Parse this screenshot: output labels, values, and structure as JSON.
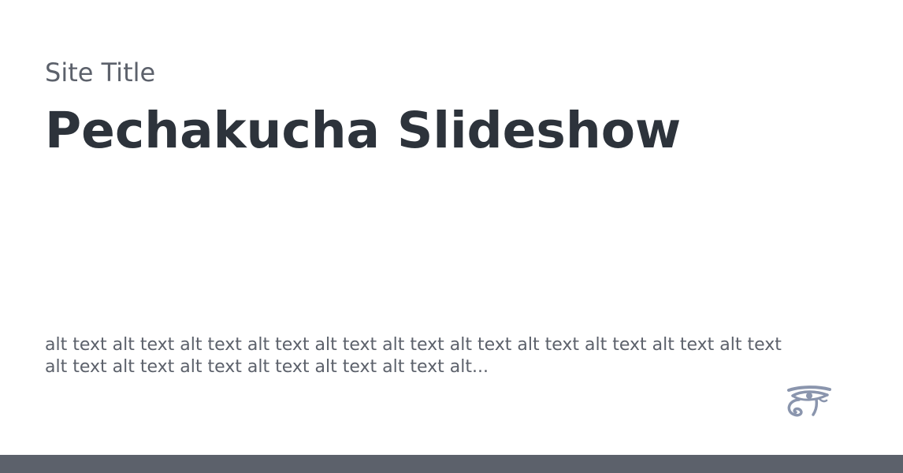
{
  "header": {
    "site_title": "Site Title",
    "page_title": "Pechakucha Slideshow"
  },
  "main": {
    "description": "alt text alt text alt text alt text alt text alt text alt text alt text alt text alt text alt text alt text alt text alt text alt text alt text alt text alt..."
  },
  "logo": {
    "icon": "eye-of-horus-icon"
  },
  "colors": {
    "site_title": "#5c616b",
    "page_title": "#2d333b",
    "logo": "#8a95ad",
    "footer_bar": "#5c616b"
  }
}
